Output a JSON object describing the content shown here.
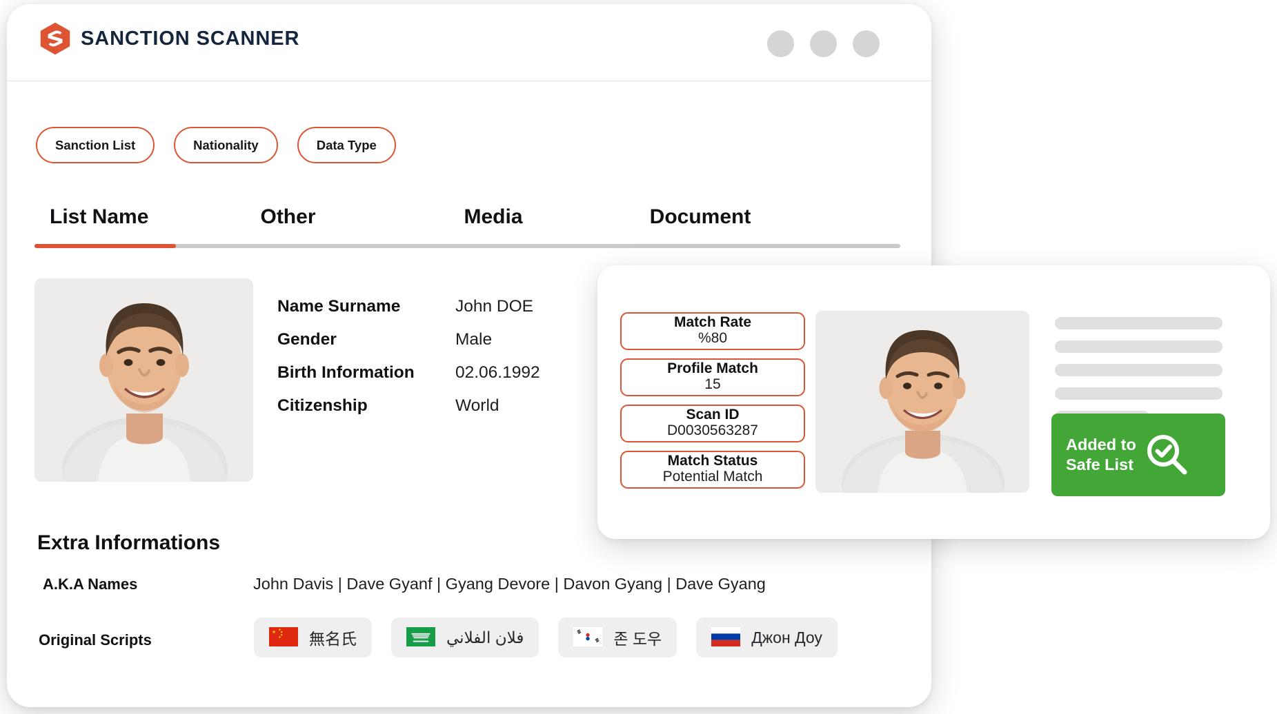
{
  "window": {
    "brand": "SANCTION SCANNER",
    "logo_icon": "sanction-scanner-hexagon-s-logo",
    "accent_color": "#de5433",
    "dot_color": "#d5d5d5",
    "dots": [
      "window-dot-1",
      "window-dot-2",
      "window-dot-3"
    ]
  },
  "filters": [
    {
      "label": "Sanction List"
    },
    {
      "label": "Nationality"
    },
    {
      "label": "Data Type"
    }
  ],
  "tabs": [
    {
      "label": "List Name",
      "active": true
    },
    {
      "label": "Other",
      "active": false
    },
    {
      "label": "Media",
      "active": false
    },
    {
      "label": "Document",
      "active": false
    }
  ],
  "profile": {
    "photo_alt": "profile-photo-smiling-man",
    "fields": [
      {
        "label": "Name Surname",
        "value": "John DOE"
      },
      {
        "label": "Gender",
        "value": "Male"
      },
      {
        "label": "Birth Information",
        "value": "02.06.1992"
      },
      {
        "label": "Citizenship",
        "value": "World"
      }
    ]
  },
  "extra": {
    "heading": "Extra Informations",
    "aka_label": "A.K.A Names",
    "aka_value": "John Davis  | Dave Gyanf |  Gyang Devore | Davon Gyang | Dave Gyang",
    "scripts_label": "Original Scripts",
    "scripts": [
      {
        "flag": "china-flag",
        "text": "無名氏"
      },
      {
        "flag": "saudi-arabia-flag",
        "text": "فلان الفلاني"
      },
      {
        "flag": "south-korea-flag",
        "text": "존 도우"
      },
      {
        "flag": "russia-flag",
        "text": "Джон Доу"
      }
    ]
  },
  "match_card": {
    "boxes": [
      {
        "title": "Match Rate",
        "value": "%80"
      },
      {
        "title": "Profile Match",
        "value": "15"
      },
      {
        "title": "Scan ID",
        "value": "D0030563287"
      },
      {
        "title": "Match Status",
        "value": "Potential Match"
      }
    ],
    "photo_alt": "match-photo-smiling-man",
    "skeleton_lines": 5,
    "badge": {
      "line1": "Added to",
      "line2": "Safe List",
      "icon": "magnifier-check-icon",
      "color": "#43a738"
    }
  }
}
